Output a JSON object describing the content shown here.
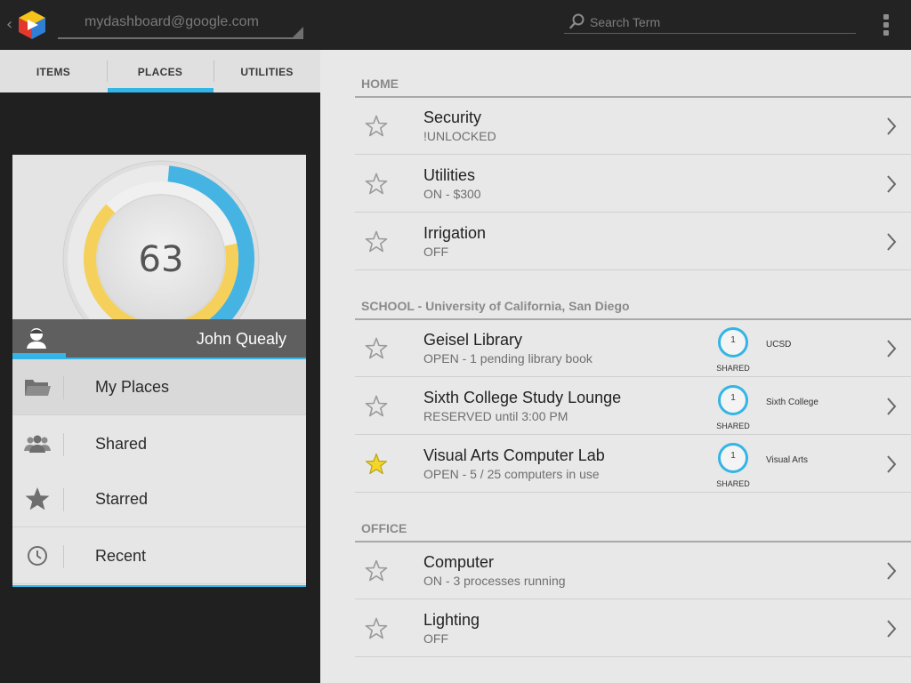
{
  "topbar": {
    "account_email": "mydashboard@google.com",
    "search_placeholder": "Search Term"
  },
  "tabs": [
    {
      "label": "ITEMS"
    },
    {
      "label": "PLACES",
      "selected": true
    },
    {
      "label": "UTILITIES"
    }
  ],
  "profile": {
    "gauge_value": "63",
    "user_name": "John Quealy"
  },
  "nav": [
    {
      "label": "My Places",
      "icon": "folder-icon",
      "selected": true
    },
    {
      "label": "Shared",
      "icon": "people-icon"
    },
    {
      "label": "Starred",
      "icon": "star-icon"
    },
    {
      "label": "Recent",
      "icon": "clock-icon"
    }
  ],
  "sections": [
    {
      "header": "HOME",
      "rows": [
        {
          "title": "Security",
          "subtitle": "!UNLOCKED",
          "starred": false
        },
        {
          "title": "Utilities",
          "subtitle": "ON - $300",
          "starred": false
        },
        {
          "title": "Irrigation",
          "subtitle": "OFF",
          "starred": false
        }
      ]
    },
    {
      "header": "SCHOOL - University of California, San Diego",
      "rows": [
        {
          "title": "Geisel Library",
          "subtitle": "OPEN - 1 pending library book",
          "starred": false,
          "share_count": "1",
          "share_label": "SHARED",
          "group": "UCSD"
        },
        {
          "title": "Sixth College Study Lounge",
          "subtitle": "RESERVED until 3:00 PM",
          "starred": false,
          "share_count": "1",
          "share_label": "SHARED",
          "group": "Sixth College"
        },
        {
          "title": "Visual Arts Computer Lab",
          "subtitle": "OPEN - 5 / 25 computers in use",
          "starred": true,
          "share_count": "1",
          "share_label": "SHARED",
          "group": "Visual Arts"
        }
      ]
    },
    {
      "header": "OFFICE",
      "rows": [
        {
          "title": "Computer",
          "subtitle": "ON - 3 processes running",
          "starred": false
        },
        {
          "title": "Lighting",
          "subtitle": "OFF",
          "starred": false
        }
      ]
    }
  ],
  "colors": {
    "accent": "#33b5e5",
    "gauge_yellow": "#f5d05a",
    "star_filled": "#f3d628",
    "star_outline": "#9a9a9a"
  }
}
